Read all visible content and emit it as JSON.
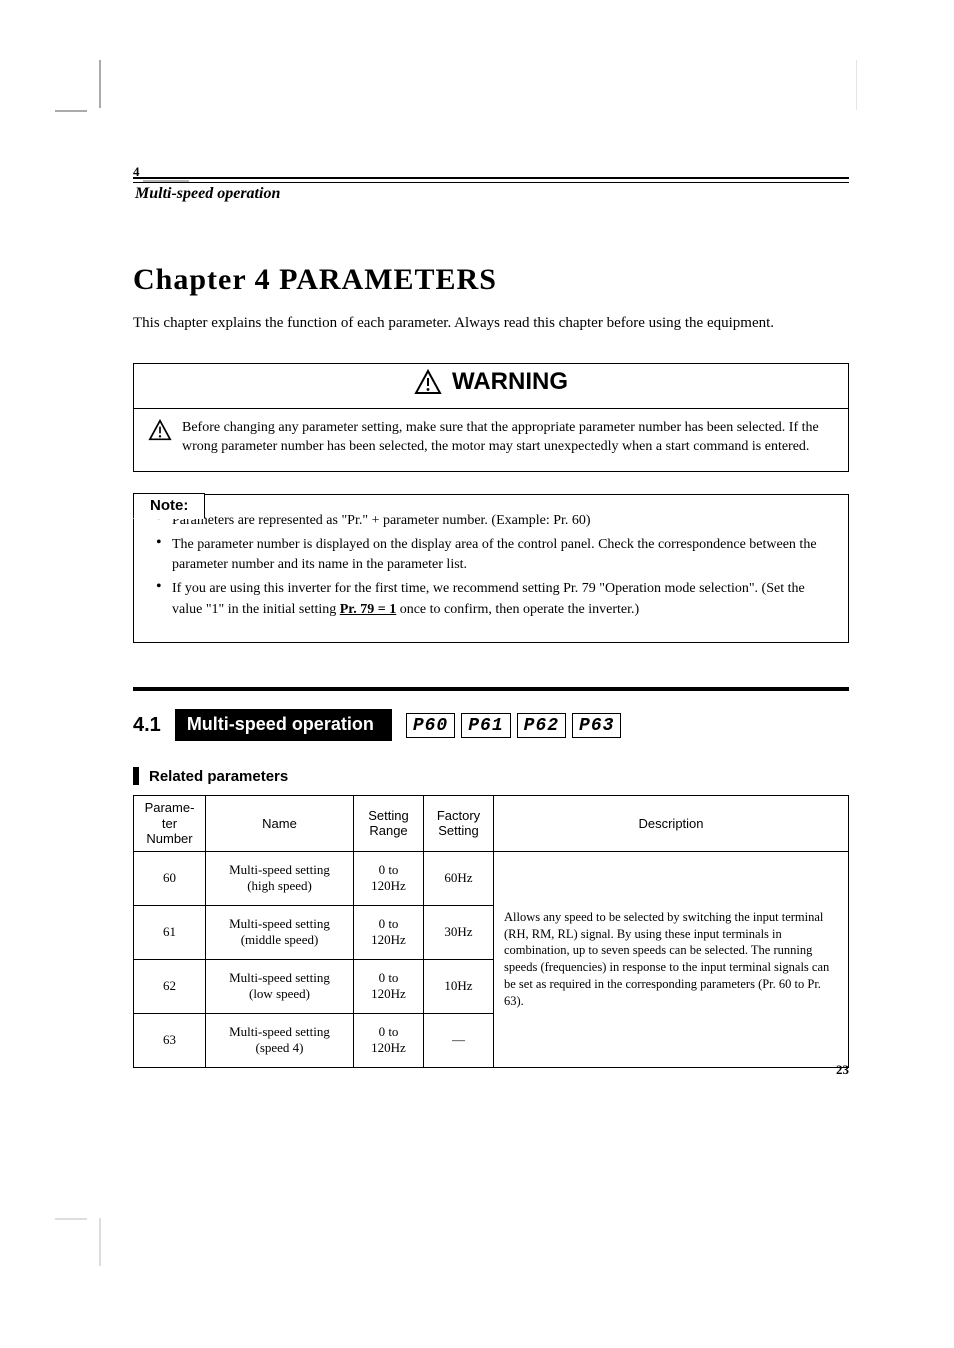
{
  "page_label_top": "4",
  "header_subtitle": "Multi-speed operation",
  "chapter_title": "Chapter 4  PARAMETERS",
  "chapter_caption": "This chapter explains the function of each parameter. Always read this chapter before using the equipment.",
  "warning": {
    "label": "WARNING",
    "icon_name": "warning-triangle-icon",
    "body_icon_name": "warning-triangle-icon",
    "body_text": "Before changing any parameter setting, make sure that the appropriate parameter number has been selected. If the wrong parameter number has been selected, the motor may start unexpectedly when a start command is entered."
  },
  "note": {
    "tab": "Note:",
    "items": [
      "Parameters are represented as \"Pr.\" + parameter number. (Example: Pr. 60)",
      "The parameter number is displayed on the display area of the control panel. Check the correspondence between the parameter number and its name in the parameter list.",
      {
        "prefix": "If you are using this inverter for the first time, we recommend setting Pr. 79 \"Operation mode selection\". (Set the value \"1\" in the initial setting ",
        "emph": "Pr. 79 = 1",
        "suffix": " once to confirm, then operate the inverter.)"
      }
    ]
  },
  "section": {
    "number": "4.1",
    "title": "Multi-speed operation",
    "displays": [
      "P60",
      "P61",
      "P62",
      "P63"
    ]
  },
  "params_heading": "Related parameters",
  "params_table": {
    "headers": {
      "num": "Parame-\nter\nNumber",
      "name": "Name",
      "range": "Setting\nRange",
      "factory": "Factory\nSetting",
      "desc": "Description"
    },
    "rows": [
      {
        "num": "60",
        "name": "Multi-speed setting\n(high speed)",
        "range": "0 to\n120Hz",
        "factory": "60Hz"
      },
      {
        "num": "61",
        "name": "Multi-speed setting\n(middle speed)",
        "range": "0 to\n120Hz",
        "factory": "30Hz"
      },
      {
        "num": "62",
        "name": "Multi-speed setting\n(low speed)",
        "range": "0 to\n120Hz",
        "factory": "10Hz"
      },
      {
        "num": "63",
        "name": "Multi-speed setting\n(speed 4)",
        "range": "0 to\n120Hz",
        "factory": "—"
      }
    ],
    "description": "Allows any speed to be selected by switching the input terminal (RH, RM, RL) signal. By using these input terminals in combination, up to seven speeds can be selected. The running speeds (frequencies) in response to the input terminal signals can be set as required in the corresponding parameters (Pr. 60 to Pr. 63)."
  },
  "footer_page": "23"
}
